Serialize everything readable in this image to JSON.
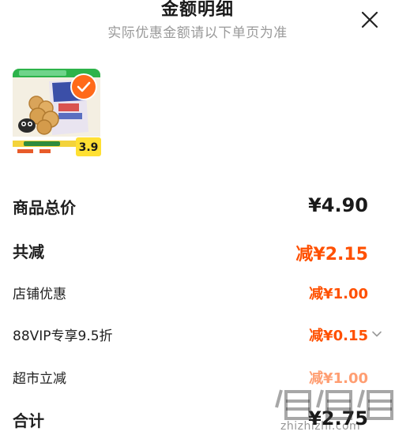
{
  "header": {
    "title": "金额明细",
    "subtitle": "实际优惠金额请以下单页为准"
  },
  "icons": {
    "close": "close-icon",
    "check": "check-icon",
    "chevron": "chevron-down-icon"
  },
  "product": {
    "price_tag": "3.9",
    "selected": true
  },
  "rows": {
    "total": {
      "label": "商品总价",
      "value": "¥4.90"
    },
    "discount_total": {
      "label": "共减",
      "value": "减¥2.15"
    },
    "shop_coupon": {
      "label": "店铺优惠",
      "value": "减¥1.00"
    },
    "vip": {
      "label": "88VIP专享9.5折",
      "value": "减¥0.15"
    },
    "market": {
      "label": "超市立减",
      "value": "减¥1.00"
    },
    "sum": {
      "label": "合计",
      "value": "¥2.75"
    }
  },
  "watermark": {
    "text": "zhizhizhi.com"
  },
  "colors": {
    "accent": "#ff5000",
    "check_bg": "#ff6a1a",
    "text": "#1f1f1f",
    "subtitle": "#9a9a9a"
  }
}
